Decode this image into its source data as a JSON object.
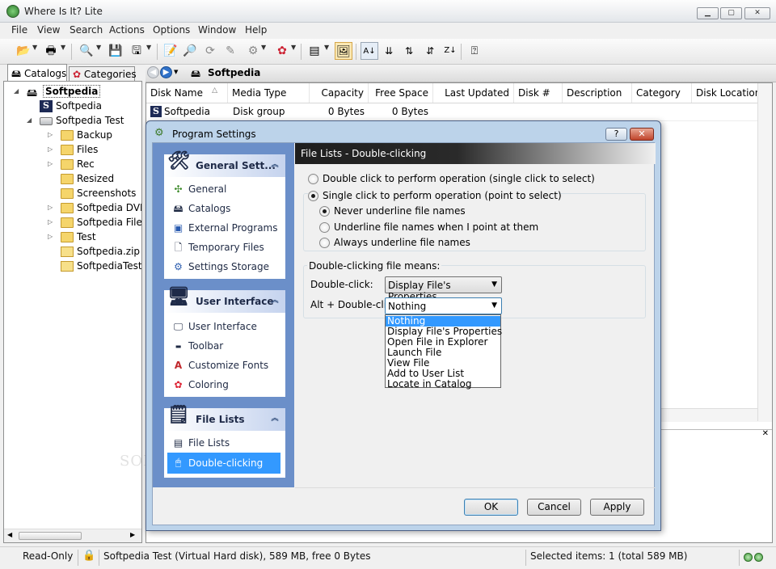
{
  "app": {
    "title": "Where Is It? Lite"
  },
  "menu": [
    "File",
    "View",
    "Search",
    "Actions",
    "Options",
    "Window",
    "Help"
  ],
  "left_tabs": [
    "Catalogs",
    "Categories"
  ],
  "tree": [
    {
      "label": "Softpedia",
      "level": 0,
      "icon": "catalog",
      "toggle": "◢"
    },
    {
      "label": "Softpedia",
      "level": 1,
      "icon": "s"
    },
    {
      "label": "Softpedia Test",
      "level": 1,
      "icon": "hdd",
      "toggle": "◢"
    },
    {
      "label": "Backup",
      "level": 2,
      "icon": "folder",
      "toggle": "▷"
    },
    {
      "label": "Files",
      "level": 2,
      "icon": "folder",
      "toggle": "▷"
    },
    {
      "label": "Rec",
      "level": 2,
      "icon": "folder",
      "toggle": "▷"
    },
    {
      "label": "Resized",
      "level": 2,
      "icon": "folder"
    },
    {
      "label": "Screenshots",
      "level": 2,
      "icon": "folder"
    },
    {
      "label": "Softpedia DVD",
      "level": 2,
      "icon": "folder",
      "toggle": "▷"
    },
    {
      "label": "Softpedia Files",
      "level": 2,
      "icon": "folder",
      "toggle": "▷"
    },
    {
      "label": "Test",
      "level": 2,
      "icon": "folder",
      "toggle": "▷"
    },
    {
      "label": "Softpedia.zip",
      "level": 2,
      "icon": "zip"
    },
    {
      "label": "SoftpediaTest",
      "level": 2,
      "icon": "zip"
    }
  ],
  "path": {
    "label": "Softpedia"
  },
  "columns": [
    "Disk Name",
    "Media Type",
    "Capacity",
    "Free Space",
    "Last Updated",
    "Disk #",
    "Description",
    "Category",
    "Disk Location"
  ],
  "rows": [
    {
      "Disk Name": "Softpedia",
      "Media Type": "Disk group",
      "Capacity": "0 Bytes",
      "Free Space": "0 Bytes"
    }
  ],
  "status": {
    "mode": "Read-Only",
    "info": "Softpedia Test (Virtual Hard disk), 589 MB, free 0 Bytes",
    "selection": "Selected items: 1 (total 589 MB)"
  },
  "dialog": {
    "title": "Program Settings",
    "header": "File Lists - Double-clicking",
    "groups": [
      {
        "title": "General Sett...",
        "items": [
          "General",
          "Catalogs",
          "External Programs",
          "Temporary Files",
          "Settings Storage"
        ]
      },
      {
        "title": "User Interface",
        "items": [
          "User Interface",
          "Toolbar",
          "Customize Fonts",
          "Coloring"
        ]
      },
      {
        "title": "File Lists",
        "items": [
          "File Lists",
          "Double-clicking"
        ]
      }
    ],
    "selected_item": "Double-clicking",
    "radio_main": [
      {
        "label": "Double click to perform operation (single click to select)",
        "checked": false
      },
      {
        "label": "Single click to perform operation (point to select)",
        "checked": true
      }
    ],
    "radio_sub": [
      {
        "label": "Never underline file names",
        "checked": true
      },
      {
        "label": "Underline file names when I point at them",
        "checked": false
      },
      {
        "label": "Always underline file names",
        "checked": false
      }
    ],
    "section_title": "Double-clicking file means:",
    "double_click_label": "Double-click:",
    "double_click_value": "Display File's Properties",
    "alt_double_click_label": "Alt + Double-click:",
    "alt_double_click_value": "Nothing",
    "options": [
      "Nothing",
      "Display File's Properties",
      "Open File in Explorer",
      "Launch File",
      "View File",
      "Add to User List",
      "Locate in Catalog"
    ],
    "buttons": {
      "ok": "OK",
      "cancel": "Cancel",
      "apply": "Apply"
    },
    "help_btn": "?",
    "close_btn": "✕"
  },
  "colors": {
    "accent": "#3399ff",
    "nav_bg": "#6b8fc9",
    "header_dark": "#1e1e1e"
  }
}
